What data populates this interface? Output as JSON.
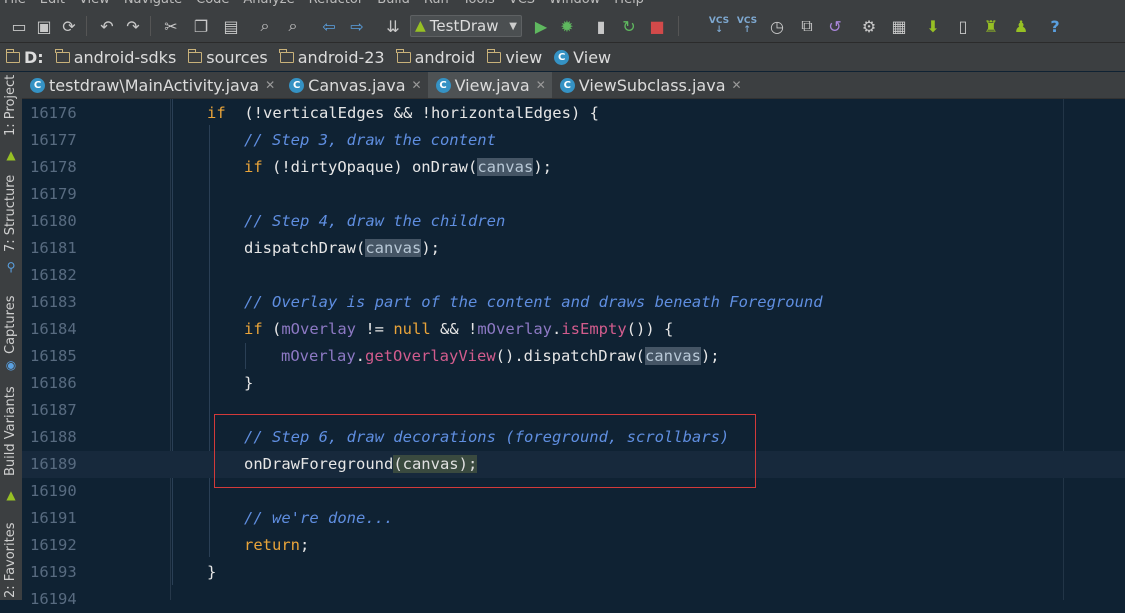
{
  "menu": [
    "File",
    "Edit",
    "View",
    "Navigate",
    "Code",
    "Analyze",
    "Refactor",
    "Build",
    "Run",
    "Tools",
    "VCS",
    "Window",
    "Help"
  ],
  "toolbar": {
    "run_config": "TestDraw",
    "vcs_label_1": "VCS",
    "vcs_label_2": "VCS",
    "help": "?"
  },
  "breadcrumb": [
    {
      "label": "D:",
      "icon": "folder-icon"
    },
    {
      "label": "android-sdks",
      "icon": "folder-icon"
    },
    {
      "label": "sources",
      "icon": "folder-icon"
    },
    {
      "label": "android-23",
      "icon": "folder-icon"
    },
    {
      "label": "android",
      "icon": "folder-icon"
    },
    {
      "label": "view",
      "icon": "folder-icon"
    },
    {
      "label": "View",
      "icon": "class-icon"
    }
  ],
  "tabs": [
    {
      "label": "testdraw\\MainActivity.java",
      "active": false
    },
    {
      "label": "Canvas.java",
      "active": false
    },
    {
      "label": "View.java",
      "active": true
    },
    {
      "label": "ViewSubclass.java",
      "active": false
    }
  ],
  "side_tools": [
    "1: Project",
    "7: Structure",
    "Captures",
    "Build Variants",
    "2: Favorites"
  ],
  "editor": {
    "line_numbers": [
      "16176",
      "16177",
      "16178",
      "16179",
      "16180",
      "16181",
      "16182",
      "16183",
      "16184",
      "16185",
      "16186",
      "16187",
      "16188",
      "16189",
      "16190",
      "16191",
      "16192",
      "16193",
      "16194"
    ],
    "current_line": "16189",
    "lines": [
      {
        "indent": 0,
        "tokens": [
          [
            "kw",
            "if"
          ],
          [
            "",
            "  (!verticalEdges && !horizontalEdges) {"
          ]
        ]
      },
      {
        "indent": 1,
        "tokens": [
          [
            "cm",
            "// Step 3, draw the content"
          ]
        ]
      },
      {
        "indent": 1,
        "tokens": [
          [
            "kw",
            "if"
          ],
          [
            "",
            " (!dirtyOpaque) onDraw("
          ],
          [
            "hl",
            "canvas"
          ],
          [
            "",
            ");"
          ]
        ]
      },
      {
        "indent": 1,
        "tokens": []
      },
      {
        "indent": 1,
        "tokens": [
          [
            "cm",
            "// Step 4, draw the children"
          ]
        ]
      },
      {
        "indent": 1,
        "tokens": [
          [
            "",
            "dispatchDraw("
          ],
          [
            "hl",
            "canvas"
          ],
          [
            "",
            ");"
          ]
        ]
      },
      {
        "indent": 1,
        "tokens": []
      },
      {
        "indent": 1,
        "tokens": [
          [
            "cm",
            "// Overlay is part of the content and draws beneath Foreground"
          ]
        ]
      },
      {
        "indent": 1,
        "tokens": [
          [
            "kw",
            "if"
          ],
          [
            "",
            " ("
          ],
          [
            "fld",
            "mOverlay"
          ],
          [
            "",
            " != "
          ],
          [
            "kw",
            "null"
          ],
          [
            "",
            " && !"
          ],
          [
            "fld",
            "mOverlay"
          ],
          [
            "",
            "."
          ],
          [
            "mth",
            "isEmpty"
          ],
          [
            "",
            "()) {"
          ]
        ]
      },
      {
        "indent": 2,
        "tokens": [
          [
            "fld",
            "mOverlay"
          ],
          [
            "",
            "."
          ],
          [
            "mth",
            "getOverlayView"
          ],
          [
            "",
            "().dispatchDraw("
          ],
          [
            "hl",
            "canvas"
          ],
          [
            "",
            ");"
          ]
        ]
      },
      {
        "indent": 1,
        "tokens": [
          [
            "",
            "}"
          ]
        ]
      },
      {
        "indent": 1,
        "tokens": []
      },
      {
        "indent": 1,
        "tokens": [
          [
            "cm",
            "// Step 6, draw decorations (foreground, scrollbars)"
          ]
        ]
      },
      {
        "indent": 1,
        "tokens": [
          [
            "",
            "onDrawForeground"
          ],
          [
            "hl2",
            "(canvas);"
          ]
        ]
      },
      {
        "indent": 1,
        "tokens": []
      },
      {
        "indent": 1,
        "tokens": [
          [
            "cm",
            "// we're done..."
          ]
        ]
      },
      {
        "indent": 1,
        "tokens": [
          [
            "kw",
            "return"
          ],
          [
            "",
            ";"
          ]
        ]
      },
      {
        "indent": 0,
        "tokens": [
          [
            "",
            "}"
          ]
        ]
      },
      {
        "indent": 0,
        "tokens": []
      }
    ]
  },
  "colors": {
    "editor_bg": "#0f2233",
    "keyword": "#e9a43a",
    "comment": "#5f8ee0",
    "field": "#8d79c4",
    "method": "#d25c8d",
    "annotation_box": "#d23a3a"
  }
}
